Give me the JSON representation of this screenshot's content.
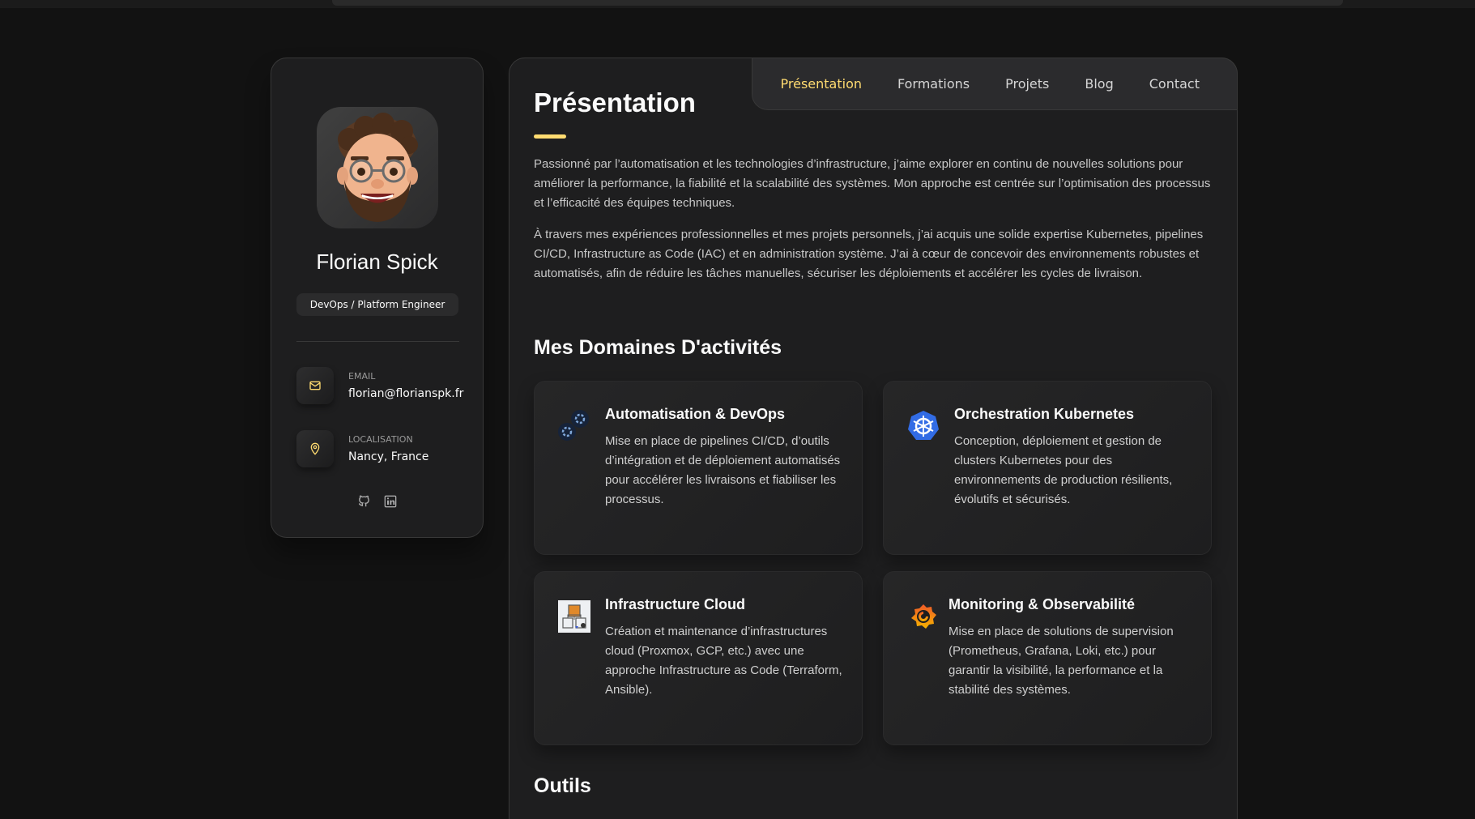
{
  "profile": {
    "name": "Florian Spick",
    "role": "DevOps / Platform Engineer",
    "contacts": [
      {
        "label": "EMAIL",
        "value": "florian@florianspk.fr",
        "icon": "mail-icon"
      },
      {
        "label": "LOCALISATION",
        "value": "Nancy, France",
        "icon": "location-pin-icon"
      }
    ],
    "socials": [
      {
        "icon": "github-icon"
      },
      {
        "icon": "linkedin-icon"
      }
    ]
  },
  "nav": {
    "items": [
      "Présentation",
      "Formations",
      "Projets",
      "Blog",
      "Contact"
    ],
    "active": "Présentation"
  },
  "main": {
    "title": "Présentation",
    "paragraphs": [
      "Passionné par l’automatisation et les technologies d’infrastructure, j’aime explorer en continu de nouvelles solutions pour améliorer la performance, la fiabilité et la scalabilité des systèmes. Mon approche est centrée sur l’optimisation des processus et l’efficacité des équipes techniques.",
      "À travers mes expériences professionnelles et mes projets personnels, j’ai acquis une solide expertise Kubernetes, pipelines CI/CD, Infrastructure as Code (IAC) et en administration système. J’ai à cœur de concevoir des environnements robustes et automatisés, afin de réduire les tâches manuelles, sécuriser les déploiements et accélérer les cycles de livraison."
    ],
    "services_title": "Mes Domaines D'activités",
    "services": [
      {
        "title": "Automatisation & DevOps",
        "text": "Mise en place de pipelines CI/CD, d’outils d’intégration et de déploiement automatisés pour accélérer les livraisons et fiabiliser les processus.",
        "icon": "gears-icon"
      },
      {
        "title": "Orchestration Kubernetes",
        "text": "Conception, déploiement et gestion de clusters Kubernetes pour des environnements de production résilients, évolutifs et sécurisés.",
        "icon": "kubernetes-icon"
      },
      {
        "title": "Infrastructure Cloud",
        "text": "Création et maintenance d’infrastructures cloud (Proxmox, GCP, etc.) avec une approche Infrastructure as Code (Terraform, Ansible).",
        "icon": "cloud-infrastructure-icon"
      },
      {
        "title": "Monitoring & Observabilité",
        "text": "Mise en place de solutions de supervision (Prometheus, Grafana, Loki, etc.) pour garantir la visibilité, la performance et la stabilité des systèmes.",
        "icon": "grafana-icon"
      }
    ],
    "tools_title": "Outils"
  },
  "colors": {
    "accent": "#ffdb70",
    "background": "#121212",
    "card": "#1e1e1f"
  }
}
